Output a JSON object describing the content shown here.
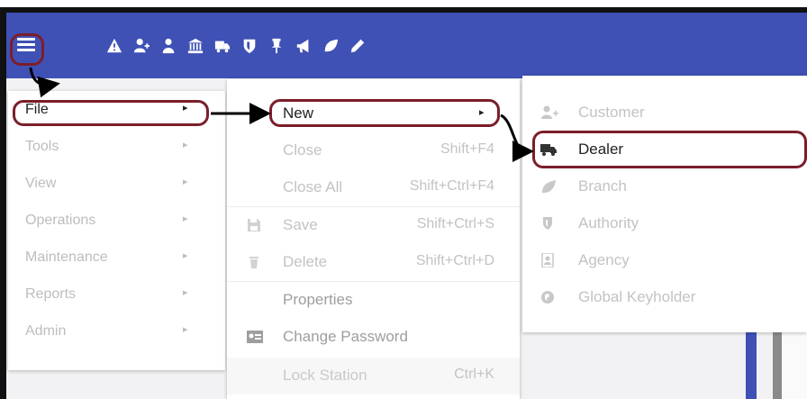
{
  "toolbar": {
    "icons": [
      "menu-icon",
      "warning-icon",
      "add-user-icon",
      "person-icon",
      "bank-icon",
      "truck-icon",
      "shield-icon",
      "pin-icon",
      "megaphone-icon",
      "leaf-icon",
      "pencil-icon"
    ],
    "accent": "#3f51b5"
  },
  "menu_file": {
    "items": [
      {
        "label": "File",
        "arrow": "▸",
        "active": true
      },
      {
        "label": "Tools",
        "arrow": "▸"
      },
      {
        "label": "View",
        "arrow": "▸"
      },
      {
        "label": "Operations",
        "arrow": "▸"
      },
      {
        "label": "Maintenance",
        "arrow": "▸"
      },
      {
        "label": "Reports",
        "arrow": "▸"
      },
      {
        "label": "Admin",
        "arrow": "▸"
      }
    ]
  },
  "menu_sub": {
    "items": [
      {
        "label": "New",
        "arrow": "▸",
        "active": true
      },
      {
        "label": "Close",
        "shortcut": "Shift+F4"
      },
      {
        "label": "Close All",
        "shortcut": "Shift+Ctrl+F4"
      },
      {
        "label": "Save",
        "shortcut": "Shift+Ctrl+S",
        "icon": "save-icon"
      },
      {
        "label": "Delete",
        "shortcut": "Shift+Ctrl+D",
        "icon": "trash-icon"
      },
      {
        "label": "Properties"
      },
      {
        "label": "Change Password",
        "icon": "id-card-icon"
      },
      {
        "label": "Lock Station",
        "shortcut": "Ctrl+K"
      }
    ]
  },
  "menu_new": {
    "items": [
      {
        "label": "Customer",
        "icon": "add-user-icon"
      },
      {
        "label": "Dealer",
        "icon": "truck-icon",
        "active": true
      },
      {
        "label": "Branch",
        "icon": "leaf-icon"
      },
      {
        "label": "Authority",
        "icon": "shield-icon"
      },
      {
        "label": "Agency",
        "icon": "portrait-icon"
      },
      {
        "label": "Global Keyholder",
        "icon": "globe-icon"
      }
    ]
  },
  "annotation_color": "#7b1e2a"
}
